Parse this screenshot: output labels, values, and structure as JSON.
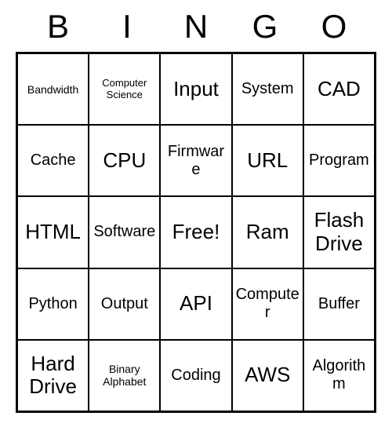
{
  "header": [
    "B",
    "I",
    "N",
    "G",
    "O"
  ],
  "cells": [
    [
      {
        "text": "Bandwidth",
        "size": "small"
      },
      {
        "text": "Computer Science",
        "size": "xsmall"
      },
      {
        "text": "Input",
        "size": "large"
      },
      {
        "text": "System",
        "size": "medium"
      },
      {
        "text": "CAD",
        "size": "large"
      }
    ],
    [
      {
        "text": "Cache",
        "size": "medium"
      },
      {
        "text": "CPU",
        "size": "large"
      },
      {
        "text": "Firmware",
        "size": "medium"
      },
      {
        "text": "URL",
        "size": "large"
      },
      {
        "text": "Program",
        "size": "medium"
      }
    ],
    [
      {
        "text": "HTML",
        "size": "large"
      },
      {
        "text": "Software",
        "size": "medium"
      },
      {
        "text": "Free!",
        "size": "large"
      },
      {
        "text": "Ram",
        "size": "large"
      },
      {
        "text": "Flash Drive",
        "size": "large"
      }
    ],
    [
      {
        "text": "Python",
        "size": "medium"
      },
      {
        "text": "Output",
        "size": "medium"
      },
      {
        "text": "API",
        "size": "large"
      },
      {
        "text": "Computer",
        "size": "medium"
      },
      {
        "text": "Buffer",
        "size": "medium"
      }
    ],
    [
      {
        "text": "Hard Drive",
        "size": "large"
      },
      {
        "text": "Binary Alphabet",
        "size": "small"
      },
      {
        "text": "Coding",
        "size": "medium"
      },
      {
        "text": "AWS",
        "size": "large"
      },
      {
        "text": "Algorithm",
        "size": "medium"
      }
    ]
  ]
}
